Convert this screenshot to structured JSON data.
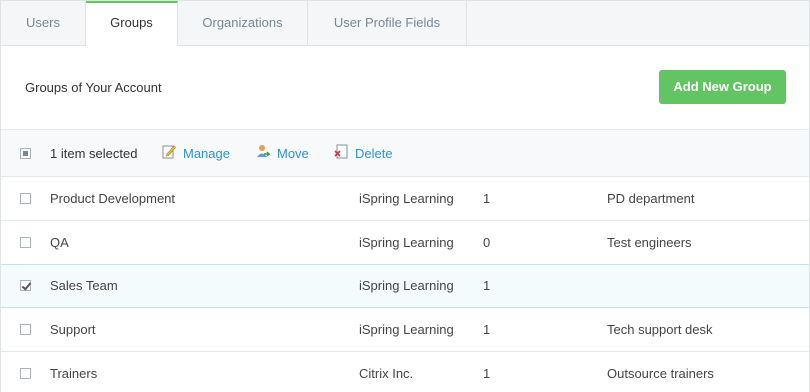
{
  "tabs": [
    {
      "label": "Users"
    },
    {
      "label": "Groups"
    },
    {
      "label": "Organizations"
    },
    {
      "label": "User Profile Fields"
    }
  ],
  "header": {
    "title": "Groups of Your Account",
    "add_button": "Add New Group"
  },
  "toolbar": {
    "selection_text": "1 item selected",
    "manage": "Manage",
    "move": "Move",
    "delete": "Delete"
  },
  "rows": [
    {
      "name": "Product Development",
      "organization": "iSpring Learning",
      "count": "1",
      "description": "PD department",
      "checked": false
    },
    {
      "name": "QA",
      "organization": "iSpring Learning",
      "count": "0",
      "description": "Test engineers",
      "checked": false
    },
    {
      "name": "Sales Team",
      "organization": "iSpring Learning",
      "count": "1",
      "description": "",
      "checked": true
    },
    {
      "name": "Support",
      "organization": "iSpring Learning",
      "count": "1",
      "description": "Tech support desk",
      "checked": false
    },
    {
      "name": "Trainers",
      "organization": "Citrix Inc.",
      "count": "1",
      "description": "Outsource trainers",
      "checked": false
    }
  ],
  "colors": {
    "accent_green": "#62c462",
    "link_blue": "#2f8fd0",
    "selected_row_bg": "#f4fbfd"
  }
}
